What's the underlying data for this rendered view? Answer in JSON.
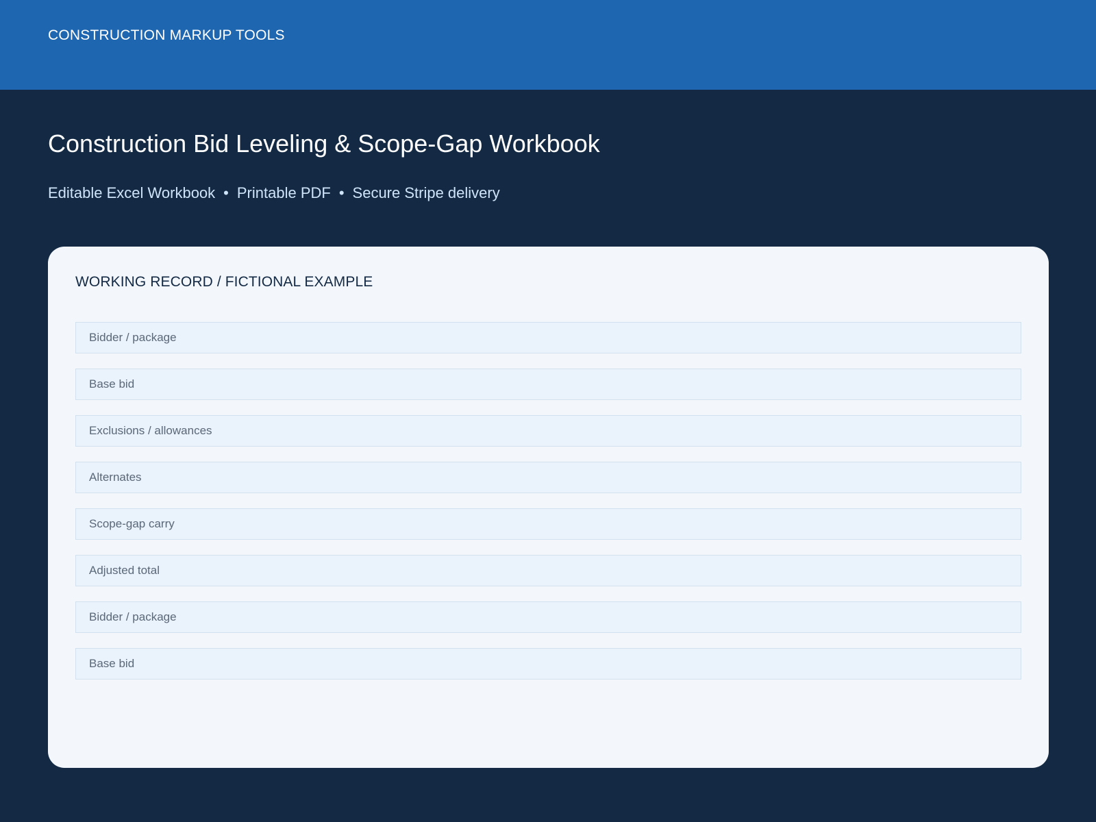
{
  "header": {
    "brand": "CONSTRUCTION MARKUP TOOLS"
  },
  "hero": {
    "title": "Construction Bid Leveling & Scope-Gap Workbook",
    "features": [
      "Editable Excel Workbook",
      "Printable PDF",
      "Secure Stripe delivery"
    ],
    "separator": "•"
  },
  "card": {
    "heading": "WORKING RECORD / FICTIONAL EXAMPLE",
    "rows": [
      {
        "label": "Bidder / package"
      },
      {
        "label": "Base bid"
      },
      {
        "label": "Exclusions / allowances"
      },
      {
        "label": "Alternates"
      },
      {
        "label": "Scope-gap carry"
      },
      {
        "label": "Adjusted total"
      },
      {
        "label": "Bidder / package"
      },
      {
        "label": "Base bid"
      }
    ]
  },
  "colors": {
    "header_bg": "#1e67b0",
    "page_bg": "#142a44",
    "card_bg": "#f3f7fb",
    "row_bg": "#eaf2fb"
  }
}
